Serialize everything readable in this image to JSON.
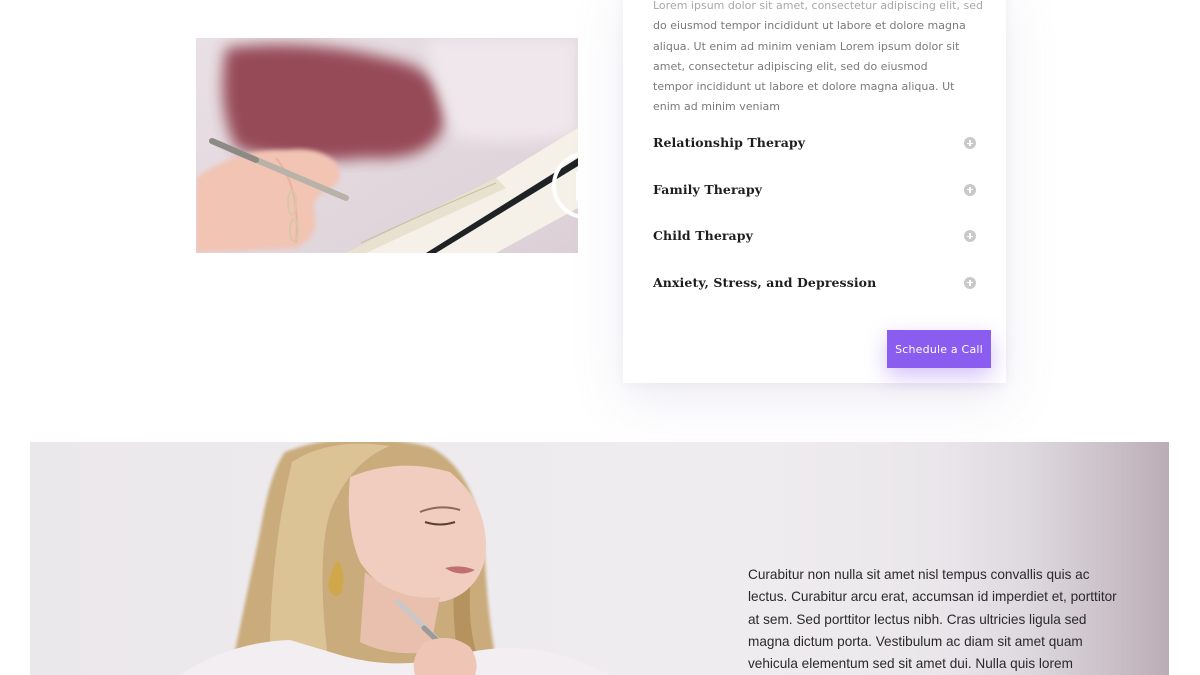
{
  "video": {
    "play_icon": "play-icon"
  },
  "services_card": {
    "intro_top": "Lorem ipsum dolor sit amet, consectetur adipiscing elit, sed",
    "intro": "do eiusmod tempor incididunt ut labore et dolore magna aliqua. Ut enim ad minim veniam Lorem ipsum dolor sit amet, consectetur adipiscing elit, sed do eiusmod tempor incididunt ut labore et dolore magna aliqua. Ut enim ad minim veniam",
    "items": [
      {
        "label": "Relationship Therapy",
        "icon": "plus-circle-icon"
      },
      {
        "label": "Family Therapy",
        "icon": "plus-circle-icon"
      },
      {
        "label": "Child Therapy",
        "icon": "plus-circle-icon"
      },
      {
        "label": "Anxiety, Stress, and Depression",
        "icon": "plus-circle-icon"
      }
    ],
    "cta_label": "Schedule a Call"
  },
  "banner": {
    "text": "Curabitur non nulla sit amet nisl tempus convallis quis ac lectus. Curabitur arcu erat, accumsan id imperdiet et, porttitor at sem. Sed porttitor lectus nibh. Cras ultricies ligula sed magna dictum porta. Vestibulum ac diam sit amet quam vehicula elementum sed sit amet dui. Nulla quis lorem"
  },
  "colors": {
    "accent": "#8a5cf0",
    "heading": "#1e1e1e",
    "body_text": "#7a7a7a",
    "toggle": "#c9c9c9"
  }
}
